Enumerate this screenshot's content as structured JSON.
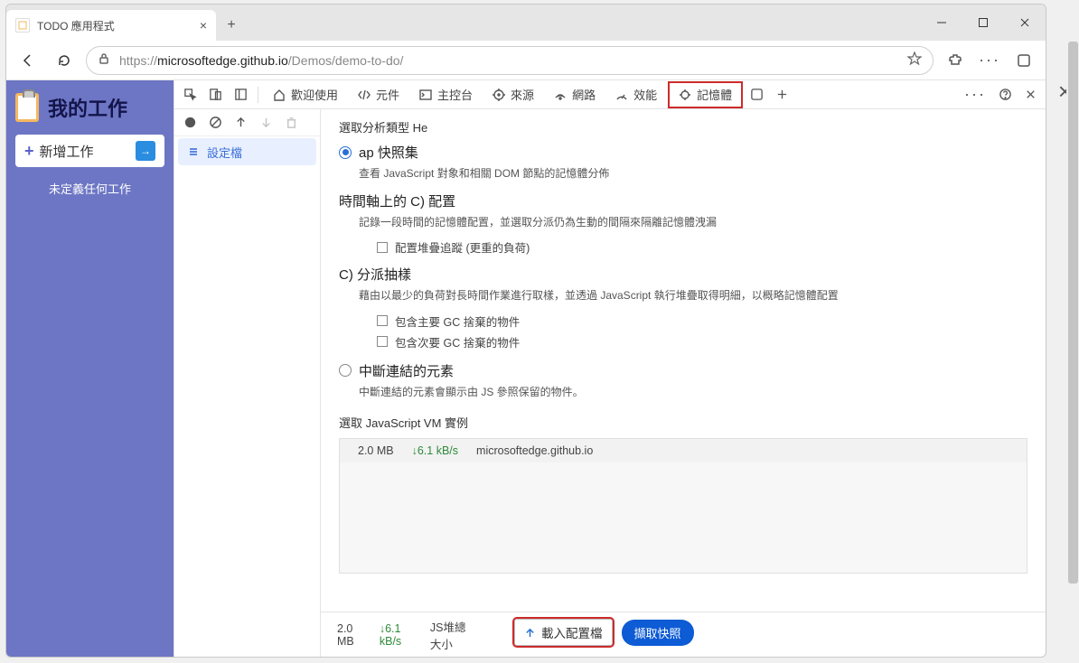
{
  "tab": {
    "title": "TODO 應用程式"
  },
  "url": {
    "prefix": "https://",
    "host": "microsoftedge.github.io",
    "path": "/Demos/demo-to-do/"
  },
  "app": {
    "title": "我的工作",
    "add_label": "新增工作",
    "empty": "未定義任何工作"
  },
  "devtools": {
    "tabs": {
      "welcome": "歡迎使用",
      "elements": "元件",
      "console": "主控台",
      "sources": "來源",
      "network": "網路",
      "performance": "效能",
      "memory": "記憶體"
    },
    "profile_item": "設定檔"
  },
  "memory": {
    "select_type": "選取分析類型 He",
    "heap_snapshot": {
      "label": "ap 快照集",
      "desc": "查看 JavaScript 對象和相關 DOM 節點的記憶體分佈"
    },
    "timeline": {
      "label": "時間軸上的 C) 配置",
      "desc": "記錄一段時間的記憶體配置，並選取分派仍為生動的間隔來隔離記憶體洩漏",
      "chk": "配置堆疊追蹤 (更重的負荷)"
    },
    "sampling": {
      "label": "C) 分派抽樣",
      "desc": "藉由以最少的負荷對長時間作業進行取樣，並透過 JavaScript 執行堆疊取得明細，以概略記憶體配置",
      "chk1": "包含主要 GC 捨棄的物件",
      "chk2": "包含次要 GC 捨棄的物件"
    },
    "detached": {
      "label": "中斷連結的元素",
      "desc": "中斷連結的元素會顯示由 JS 參照保留的物件。"
    },
    "vm_title": "選取 JavaScript VM 實例",
    "vm_row": {
      "size": "2.0 MB",
      "rate": "↓6.1 kB/s",
      "origin": "microsoftedge.github.io"
    },
    "footer": {
      "size": "2.0 MB",
      "rate": "↓6.1 kB/s",
      "heap_total": "JS堆總大小",
      "load_btn": "載入配置檔",
      "snapshot_btn": "擷取快照"
    }
  }
}
